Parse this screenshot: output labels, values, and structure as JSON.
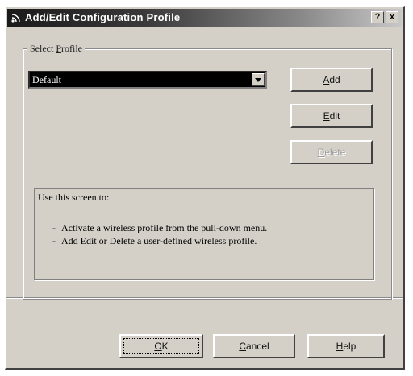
{
  "window": {
    "title": "Add/Edit Configuration Profile",
    "help_button": "?",
    "close_button": "x"
  },
  "profile_group": {
    "label_prefix": "Select ",
    "label_accel": "P",
    "label_suffix": "rofile",
    "selected_profile": "Default"
  },
  "buttons": {
    "add": {
      "accel": "A",
      "rest": "dd"
    },
    "edit": {
      "accel": "E",
      "rest": "dit"
    },
    "delete": {
      "accel": "D",
      "rest": "elete"
    },
    "ok": {
      "accel": "O",
      "rest": "K"
    },
    "cancel": {
      "accel": "C",
      "rest": "ancel"
    },
    "help": {
      "accel": "H",
      "rest": "elp"
    }
  },
  "info": {
    "heading": "Use this screen to:",
    "items": [
      "Activate a wireless profile from the pull-down menu.",
      "Add Edit or Delete a user-defined wireless profile."
    ]
  },
  "colors": {
    "dialog_face": "#d4d0c8",
    "selection": "#000000",
    "disabled_text": "#9a9a9a"
  },
  "icons": {
    "title_icon": "wireless-signal-icon",
    "dropdown_icon": "chevron-down-icon"
  }
}
